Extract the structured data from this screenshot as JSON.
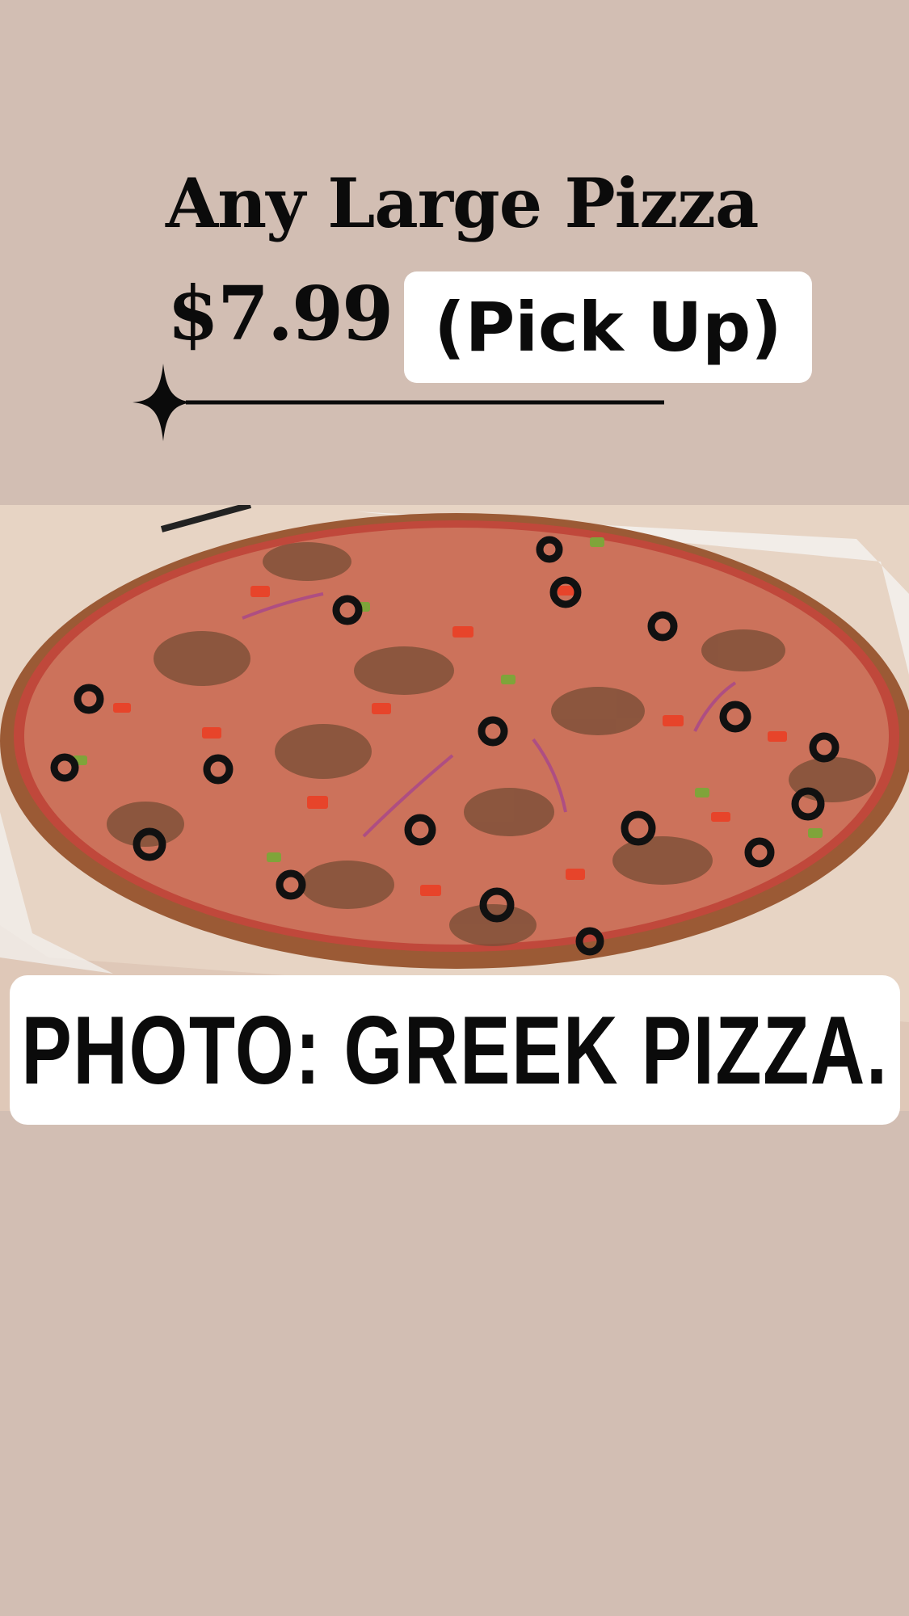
{
  "promo": {
    "title": "Any Large Pizza",
    "price": "$7.99",
    "badge": "(Pick Up)"
  },
  "photo": {
    "caption": "PHOTO: GREEK PIZZA."
  },
  "colors": {
    "background": "#d2beb3",
    "text": "#0b0b0b",
    "badge_background": "#ffffff"
  },
  "icons": [
    "sparkle-icon"
  ]
}
